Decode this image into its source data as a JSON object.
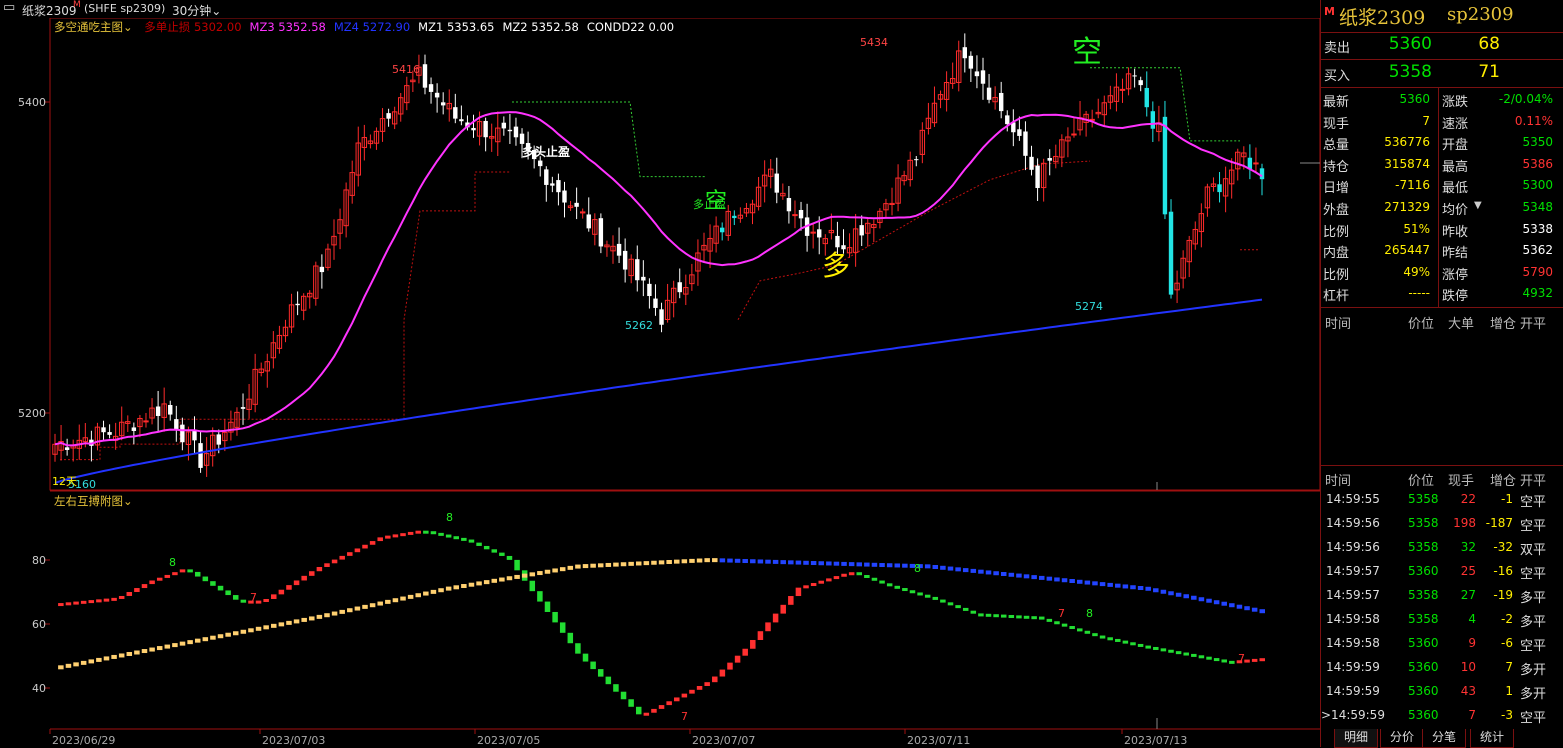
{
  "window": {
    "icon_name": "window-menu-icon",
    "instrument_title": "纸浆2309",
    "market_code": "(SHFE sp2309)",
    "period": "30分钟"
  },
  "main_chart": {
    "indicator_name": "多空通吃主图",
    "params": [
      {
        "label": "多单止损",
        "value": "5302.00",
        "color": "#c00000"
      },
      {
        "label": "MZ3",
        "value": "5352.58",
        "color": "#ff33ff"
      },
      {
        "label": "MZ4",
        "value": "5272.90",
        "color": "#2233ff"
      },
      {
        "label": "MZ1",
        "value": "5353.65",
        "color": "#ffffff"
      },
      {
        "label": "MZ2",
        "value": "5352.58",
        "color": "#ffffff"
      },
      {
        "label": "CONDD22",
        "value": "0.00",
        "color": "#ffffff"
      }
    ],
    "y_labels": [
      "5400",
      "5200"
    ],
    "annotations": {
      "high1": "5416",
      "high2": "5434",
      "low1": "5262",
      "low2": "5274",
      "low0": "5160",
      "days12": "12天",
      "long_stop_label": "多头止盈",
      "short_big": "空",
      "long_big": "多",
      "short_mid": "空",
      "mid_small": "多止盈"
    }
  },
  "sub_chart": {
    "indicator_name": "左右互搏附图",
    "y_labels": [
      "80",
      "60",
      "40"
    ],
    "markers": [
      "8",
      "7",
      "8",
      "7",
      "8",
      "7",
      "8",
      "7"
    ]
  },
  "x_axis": {
    "dates": [
      "2023/06/29",
      "2023/07/03",
      "2023/07/05",
      "2023/07/07",
      "2023/07/11",
      "2023/07/13"
    ]
  },
  "chart_data": {
    "type": "candlestick",
    "title": "纸浆2309 30分钟",
    "ylim": [
      5150,
      5450
    ],
    "bull_color": "#ff2b2b",
    "bear_color": "#ffffff",
    "ma_colors": {
      "MZ3": "#ff33ff",
      "MZ4": "#2233ff"
    },
    "highlights": {
      "high_5416": 5416,
      "high_5434": 5434,
      "low_5262": 5262,
      "low_5274": 5274,
      "low_5160": 5160
    },
    "indicator_ylim": [
      30,
      95
    ],
    "indicator_colors": {
      "rising": "#ff3030",
      "falling": "#22dd33",
      "slow_up": "#ffd070",
      "slow_down": "#2244ff"
    }
  },
  "quote_panel": {
    "market_flag": "M",
    "title": "纸浆2309",
    "code": "sp2309",
    "sell": {
      "label": "卖出",
      "price": "5360",
      "volume": "68"
    },
    "buy": {
      "label": "买入",
      "price": "5358",
      "volume": "71"
    },
    "stats_left": [
      {
        "label": "最新",
        "value": "5360",
        "color": "#00e000"
      },
      {
        "label": "现手",
        "value": "7",
        "color": "#ffee00"
      },
      {
        "label": "总量",
        "value": "536776",
        "color": "#ffee00"
      },
      {
        "label": "持仓",
        "value": "315874",
        "color": "#ffee00"
      },
      {
        "label": "日增",
        "value": "-7116",
        "color": "#ffee00"
      },
      {
        "label": "外盘",
        "value": "271329",
        "color": "#ffee00"
      },
      {
        "label": "比例",
        "value": "51%",
        "color": "#ffee00"
      },
      {
        "label": "内盘",
        "value": "265447",
        "color": "#ffee00"
      },
      {
        "label": "比例",
        "value": "49%",
        "color": "#ffee00"
      },
      {
        "label": "杠杆",
        "value": "-----",
        "color": "#ffee00"
      }
    ],
    "stats_right": [
      {
        "label": "涨跌",
        "value": "-2/0.04%",
        "color": "#00e000"
      },
      {
        "label": "速涨",
        "value": "0.11%",
        "color": "#ff3333"
      },
      {
        "label": "开盘",
        "value": "5350",
        "color": "#00e000"
      },
      {
        "label": "最高",
        "value": "5386",
        "color": "#ff3333"
      },
      {
        "label": "最低",
        "value": "5300",
        "color": "#00e000"
      },
      {
        "label": "均价",
        "value": "5348",
        "color": "#00e000"
      },
      {
        "label": "昨收",
        "value": "5338",
        "color": "#ffffff"
      },
      {
        "label": "昨结",
        "value": "5362",
        "color": "#ffffff"
      },
      {
        "label": "涨停",
        "value": "5790",
        "color": "#ff3333"
      },
      {
        "label": "跌停",
        "value": "4932",
        "color": "#00e000"
      }
    ],
    "big_order_header": [
      "时间",
      "价位",
      "大单",
      "增仓",
      "开平"
    ],
    "trade_header": [
      "时间",
      "价位",
      "现手",
      "增仓",
      "开平"
    ],
    "trades": [
      {
        "time": "14:59:55",
        "price": "5358",
        "qty": "22",
        "oi": "-1",
        "type": "空平",
        "price_color": "#00e000",
        "qty_color": "#ff3333"
      },
      {
        "time": "14:59:56",
        "price": "5358",
        "qty": "198",
        "oi": "-187",
        "type": "空平",
        "price_color": "#00e000",
        "qty_color": "#ff3333"
      },
      {
        "time": "14:59:56",
        "price": "5358",
        "qty": "32",
        "oi": "-32",
        "type": "双平",
        "price_color": "#00e000",
        "qty_color": "#00e000"
      },
      {
        "time": "14:59:57",
        "price": "5360",
        "qty": "25",
        "oi": "-16",
        "type": "空平",
        "price_color": "#00e000",
        "qty_color": "#ff3333"
      },
      {
        "time": "14:59:57",
        "price": "5358",
        "qty": "27",
        "oi": "-19",
        "type": "多平",
        "price_color": "#00e000",
        "qty_color": "#00e000"
      },
      {
        "time": "14:59:58",
        "price": "5358",
        "qty": "4",
        "oi": "-2",
        "type": "多平",
        "price_color": "#00e000",
        "qty_color": "#00e000"
      },
      {
        "time": "14:59:58",
        "price": "5360",
        "qty": "9",
        "oi": "-6",
        "type": "空平",
        "price_color": "#00e000",
        "qty_color": "#ff3333"
      },
      {
        "time": "14:59:59",
        "price": "5360",
        "qty": "10",
        "oi": "7",
        "type": "多开",
        "price_color": "#00e000",
        "qty_color": "#ff3333"
      },
      {
        "time": "14:59:59",
        "price": "5360",
        "qty": "43",
        "oi": "1",
        "type": "多开",
        "price_color": "#00e000",
        "qty_color": "#ff3333"
      },
      {
        "time": "14:59:59",
        "price": "5360",
        "qty": "7",
        "oi": "-3",
        "type": "空平",
        "price_color": "#00e000",
        "qty_color": "#ff3333",
        "current": true
      }
    ],
    "tabs": [
      "明细",
      "分价",
      "分笔",
      "统计"
    ]
  }
}
